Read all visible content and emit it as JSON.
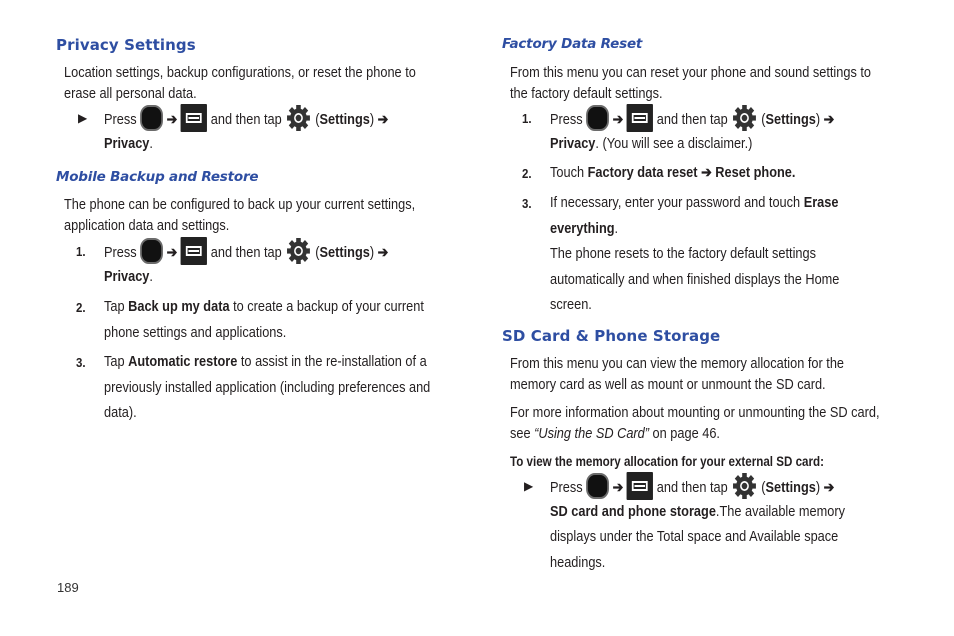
{
  "page_number": "189",
  "colors": {
    "heading": "#2e4ea2",
    "text": "#231f20"
  },
  "icons": {
    "home": "home-key-icon",
    "menu": "menu-key-icon",
    "settings": "settings-gear-icon",
    "arrow": "➔",
    "bullet": "▶"
  },
  "common": {
    "press": "Press",
    "and_then_tap": "and then tap",
    "settings_open": "(",
    "settings": "Settings",
    "settings_close": ")",
    "arrow": "➔",
    "privacy": "Privacy"
  },
  "privacy_settings": {
    "heading": "Privacy Settings",
    "para_line1": "Location settings, backup configurations, or reset the phone to",
    "para_line2": "erase all personal data.",
    "bullet": "▶",
    "period": "."
  },
  "mobile_backup": {
    "heading": "Mobile Backup and Restore",
    "para_line1": "The phone can be configured to back up your current settings,",
    "para_line2": "application data and settings.",
    "steps": [
      {
        "num": "1.",
        "period": "."
      },
      {
        "num": "2.",
        "pre": "Tap ",
        "bold": "Back up my data",
        "post": " to create a backup of your current",
        "line2": "phone settings and applications."
      },
      {
        "num": "3.",
        "pre": "Tap ",
        "bold": "Automatic restore",
        "post": " to assist in the re-installation of a",
        "line2": "previously installed application (including preferences and",
        "line3": "data)."
      }
    ]
  },
  "factory_reset": {
    "heading": "Factory Data Reset",
    "para_line1": "From this menu you can reset your phone and sound settings to",
    "para_line2": "the factory default settings.",
    "steps": [
      {
        "num": "1.",
        "post": ". (You will see a disclaimer.)"
      },
      {
        "num": "2.",
        "pre": "Touch ",
        "bold": "Factory data reset ➔ Reset phone."
      },
      {
        "num": "3.",
        "pre": "If necessary, enter your password and touch ",
        "bold": "Erase",
        "bold2": "everything",
        "post": ".",
        "line3": "The phone resets to the factory default settings",
        "line4": "automatically and when finished displays the Home",
        "line5": "screen."
      }
    ]
  },
  "sd_card": {
    "heading": "SD Card & Phone Storage",
    "para1_line1": "From this menu you can view the memory allocation for the",
    "para1_line2": "memory card as well as mount or unmount the SD card.",
    "para2_line1": "For more information about mounting or unmounting the SD card,",
    "para2_pre": "see ",
    "para2_link": "“Using the SD Card”",
    "para2_post": " on page 46.",
    "instruction": "To view the memory allocation for your external SD card:",
    "bullet": "▶",
    "bold": "SD card and phone storage",
    "post": ".The available memory",
    "line3": "displays under the Total space and Available space",
    "line4": "headings."
  }
}
